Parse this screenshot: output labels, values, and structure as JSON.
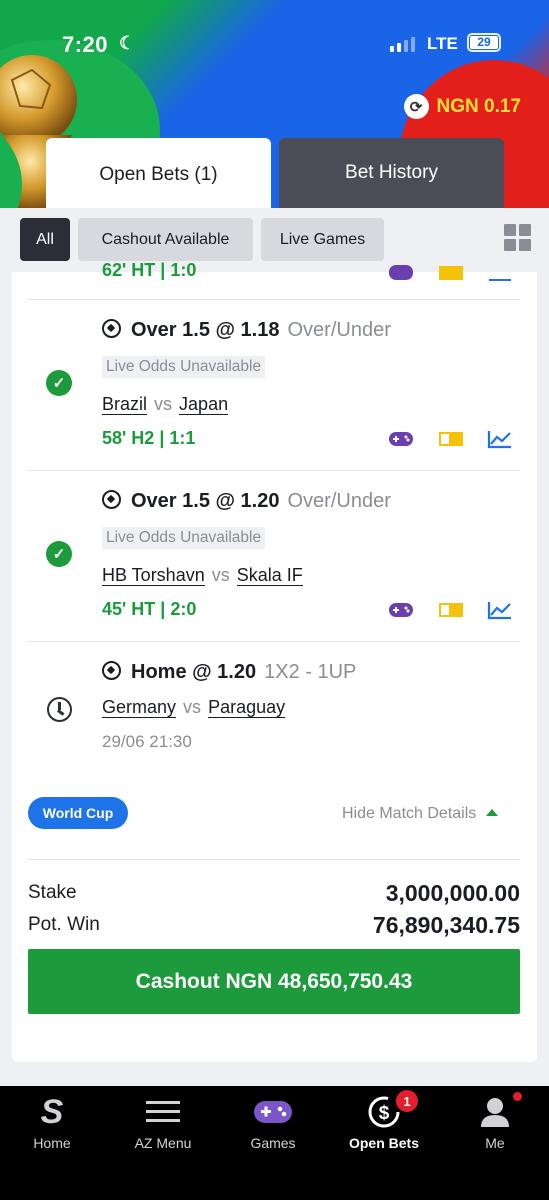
{
  "status_bar": {
    "time": "7:20",
    "network": "LTE",
    "battery": "29"
  },
  "balance": {
    "text": "NGN 0.17"
  },
  "tabs": [
    {
      "label": "Open Bets (1)",
      "active": true
    },
    {
      "label": "Bet History",
      "active": false
    }
  ],
  "filters": [
    {
      "label": "All",
      "active": true
    },
    {
      "label": "Cashout Available",
      "active": false
    },
    {
      "label": "Live Games",
      "active": false
    }
  ],
  "partial_row": {
    "score": "62' HT | 1:0"
  },
  "selections": [
    {
      "status": "won",
      "pick": "Over 1.5 @ 1.18",
      "market": "Over/Under",
      "odds_note": "Live Odds Unavailable",
      "home": "Brazil",
      "vs": "vs",
      "away": "Japan",
      "score_time": "58' H2 |",
      "score": "1:1"
    },
    {
      "status": "won",
      "pick": "Over 1.5 @ 1.20",
      "market": "Over/Under",
      "odds_note": "Live Odds Unavailable",
      "home": "HB Torshavn",
      "vs": "vs",
      "away": "Skala IF",
      "score_time": "45' HT |",
      "score": "2:0"
    },
    {
      "status": "pending",
      "pick": "Home @ 1.20",
      "market": "1X2  -  1UP",
      "home": "Germany",
      "vs": "vs",
      "away": "Paraguay",
      "date": "29/06 21:30"
    }
  ],
  "tag": "World Cup",
  "hide_details": "Hide Match Details",
  "stake": {
    "label": "Stake",
    "value": "3,000,000.00"
  },
  "pot_win": {
    "label": "Pot. Win",
    "value": "76,890,340.75"
  },
  "cashout": {
    "label": "Cashout NGN 48,650,750.43"
  },
  "nav": [
    {
      "label": "Home",
      "icon": "sporty-logo-icon"
    },
    {
      "label": "AZ Menu",
      "icon": "menu-icon"
    },
    {
      "label": "Games",
      "icon": "gamepad-icon"
    },
    {
      "label": "Open Bets",
      "icon": "open-bets-icon",
      "badge": "1",
      "active": true
    },
    {
      "label": "Me",
      "icon": "user-icon"
    }
  ],
  "colors": {
    "accent_green": "#1d9a3c",
    "tag_blue": "#1e73e8",
    "balance_yellow": "#ffe033"
  }
}
